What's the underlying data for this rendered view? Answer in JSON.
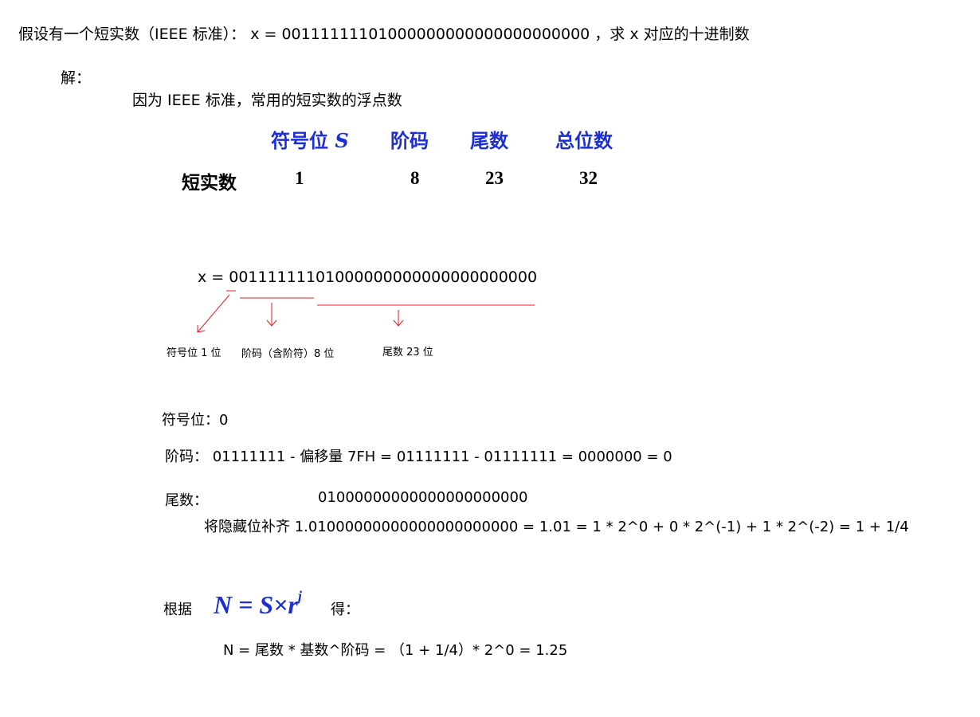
{
  "question": "假设有一个短实数（IEEE 标准）：  x = 00111111101000000000000000000000  ，求 x 对应的十进制数",
  "solution_label": "解：",
  "intro": "因为 IEEE 标准，常用的短实数的浮点数",
  "table": {
    "headers": [
      "符号位",
      "阶码",
      "尾数",
      "总位数"
    ],
    "sign_symbol": "S",
    "row_label": "短实数",
    "values": [
      "1",
      "8",
      "23",
      "32"
    ]
  },
  "binary": {
    "expression": "x = 00111111101000000000000000000000",
    "labels": {
      "sign": "符号位 1 位",
      "exponent": "阶码（含阶符）8 位",
      "mantissa": "尾数 23 位"
    }
  },
  "sign_line": "符号位：0",
  "exponent_line": "阶码：  01111111 - 偏移量 7FH = 01111111 - 01111111 = 0000000   = 0",
  "mantissa": {
    "label": "尾数：",
    "value": "01000000000000000000000",
    "hidden_bit_line": "将隐藏位补齐  1.01000000000000000000000 = 1.01 = 1 * 2^0 + 0 * 2^(-1) + 1 * 2^(-2) = 1 + 1/4"
  },
  "formula": {
    "prefix": "根据",
    "expression": "N = S×r",
    "exponent": "j",
    "suffix": "得："
  },
  "result": "N = 尾数 * 基数^阶码 = （1 + 1/4）* 2^0 = 1.25",
  "colors": {
    "accent_blue": "#1c2fd2",
    "annotation_red": "#e02020"
  }
}
